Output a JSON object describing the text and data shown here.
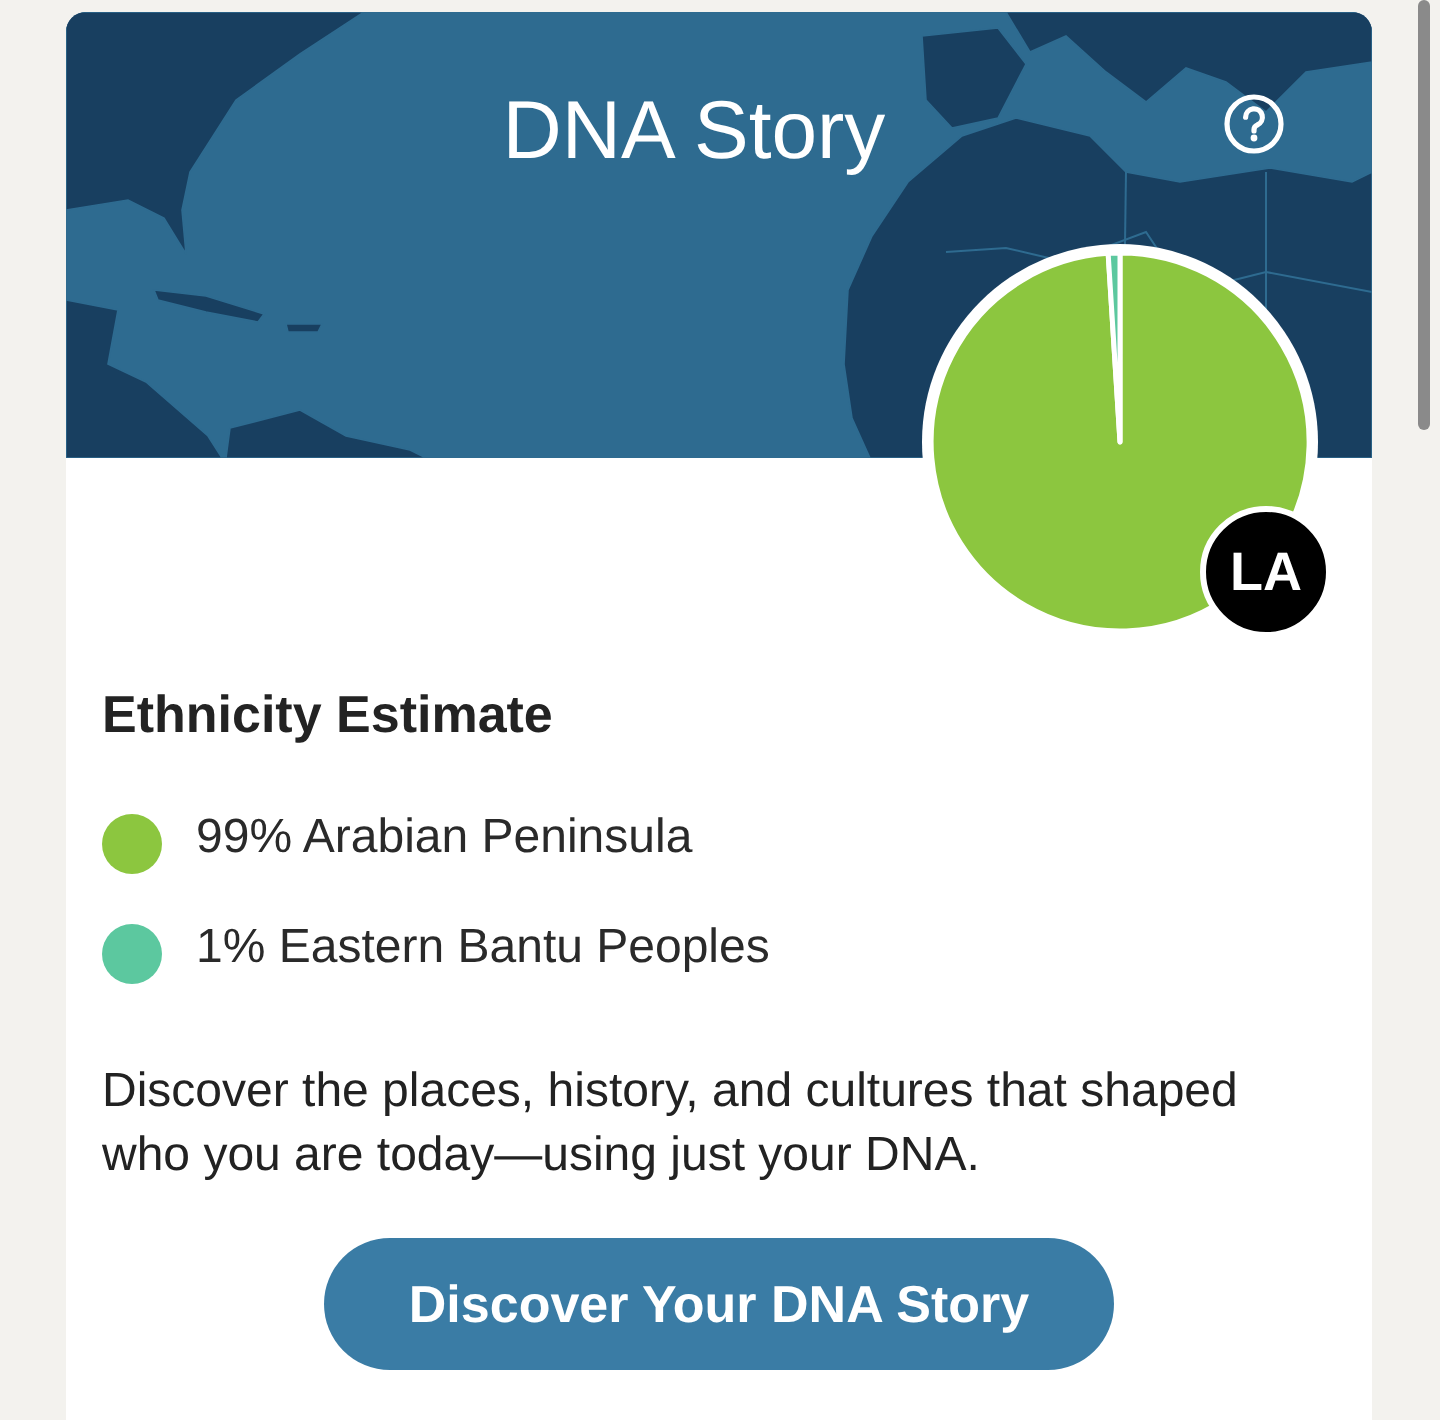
{
  "header": {
    "title": "DNA Story"
  },
  "pie_chart": {
    "chart_data": {
      "type": "pie",
      "values": [
        99,
        1
      ]
    }
  },
  "avatar": {
    "initials": "LA"
  },
  "ethnicity": {
    "title": "Ethnicity Estimate",
    "items": [
      {
        "label": "99% Arabian Peninsula",
        "color": "#8cc63f"
      },
      {
        "label": "1% Eastern Bantu Peoples",
        "color": "#5cc89f"
      }
    ]
  },
  "description": "Discover the places, history, and cultures that shaped who you are today—using just your DNA.",
  "button": {
    "label": "Discover Your DNA Story"
  }
}
